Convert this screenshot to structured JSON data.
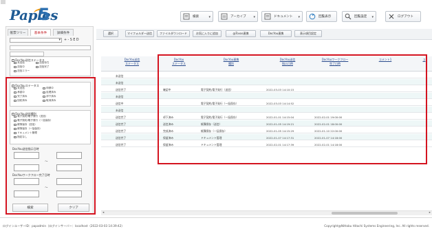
{
  "app": {
    "logo_text": "Paples",
    "logo_num": "5"
  },
  "topbar": {
    "buttons": [
      {
        "label": "検索",
        "icon": "search-list-icon"
      },
      {
        "label": "アーカイブ",
        "icon": "archive-icon"
      },
      {
        "label": "ドキュメント",
        "icon": "document-icon"
      },
      {
        "label": "回覧表示",
        "icon": "circulation-icon"
      },
      {
        "label": "回覧設定",
        "icon": "settings-search-icon"
      },
      {
        "label": "ログアウト",
        "icon": "logout-x-icon"
      }
    ]
  },
  "left": {
    "tabs": [
      "帳票ツリー",
      "基本条件",
      "詳細条件"
    ],
    "active_tab": "基本条件",
    "letters": "+ - S E D",
    "status_group": {
      "title": "DocYou送信ステータス",
      "options": [
        "未送信",
        "送信待ち",
        "送信中",
        "送信完了",
        "送信エラー"
      ]
    },
    "docyou_status_group": {
      "title": "DocYouステータス",
      "options": [
        "未送信",
        "申請中",
        "承認中",
        "処理済み",
        "完了済み",
        "却下済み",
        "回収済み",
        "取消済み"
      ]
    },
    "form_type_group": {
      "title": "DocYou送信種別",
      "options": [
        "電子契約/電子発行（送信）",
        "電子契約/電子発行（一括保存）",
        "帳簿保存（送信）",
        "帳簿保存（一括保存）",
        "ドキュメント管理",
        "指定なし"
      ]
    },
    "date_sent_label": "DocYou送信指示日時",
    "date_flow_label": "DocYouワークフロー完了日時",
    "tilde": "～",
    "search_button": "検索",
    "clear_button": "クリア"
  },
  "toolbar": {
    "buttons": [
      "選択",
      "マイフォルダー送信",
      "ファイルダウンロード",
      "お気に入りに追加",
      "@Tovas連携",
      "DocYou連携",
      "表示項目設定"
    ]
  },
  "table": {
    "headers": [
      "DocYou送信\nステータス",
      "DocYou\nステータス",
      "DocYou連携\n種別",
      "DocYou送信\n指示日時",
      "DocYouワークフロー\n完了日時",
      "コメント1",
      "コ"
    ],
    "rows": [
      {
        "send_status": "未送信",
        "docyou_status": "",
        "type": "",
        "sent_at": "",
        "done_at": ""
      },
      {
        "send_status": "未送信",
        "docyou_status": "",
        "type": "",
        "sent_at": "",
        "done_at": ""
      },
      {
        "send_status": "送信完了",
        "docyou_status": "確認中",
        "type": "電子契約/電子発行（送信）",
        "sent_at": "2022-03-03 14:10:15",
        "done_at": ""
      },
      {
        "send_status": "未送信",
        "docyou_status": "",
        "type": "",
        "sent_at": "",
        "done_at": ""
      },
      {
        "send_status": "送信中",
        "docyou_status": "",
        "type": "電子契約/電子発行（一括保存）",
        "sent_at": "2022-03-03 14:14:52",
        "done_at": ""
      },
      {
        "send_status": "未送信",
        "docyou_status": "",
        "type": "",
        "sent_at": "",
        "done_at": ""
      },
      {
        "send_status": "送信完了",
        "docyou_status": "却下済み",
        "type": "電子契約/電子発行（一括保存）",
        "sent_at": "2022-01-01 14:15:04",
        "done_at": "2022-02-01 19:00:00"
      },
      {
        "send_status": "送信完了",
        "docyou_status": "送信済み",
        "type": "帳簿保存（送信）",
        "sent_at": "2022-01-05 14:19:21",
        "done_at": "2022-02-01 18:00:00"
      },
      {
        "send_status": "送信完了",
        "docyou_status": "完成済み",
        "type": "帳簿保存（一括保存）",
        "sent_at": "2022-01-05 14:15:29",
        "done_at": "2022-01-10 22:00:00"
      },
      {
        "send_status": "送信完了",
        "docyou_status": "保留済み",
        "type": "ドキュメント管理",
        "sent_at": "2022-01-07 14:17:31",
        "done_at": "2022-01-07 14:18:00"
      },
      {
        "send_status": "送信完了",
        "docyou_status": "保留済み",
        "type": "ドキュメント管理",
        "sent_at": "2022-02-01 14:17:39",
        "done_at": "2022-02-01 14:18:00"
      }
    ]
  },
  "footer": {
    "login_info": "ログインユーザーID：papadmin（ログインサーバー：localhost（2022-03-03 14:39:42）",
    "copyright": "Copyright@Nittobu Hitachi Systems Engineering, Inc. All rights reserved."
  },
  "colors": {
    "highlight": "#d4131f",
    "brand": "#1f5b94",
    "accent": "#f4a11a"
  }
}
